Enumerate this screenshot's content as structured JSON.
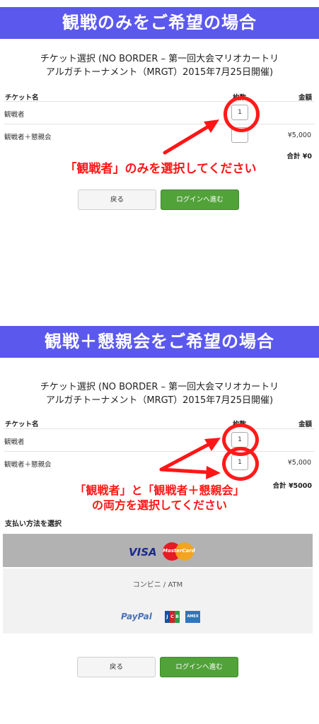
{
  "section1": {
    "banner": "観戦のみをご希望の場合",
    "title_line1": "チケット選択 (NO BORDER – 第一回大会マリオカートリ",
    "title_line2": "アルガチトーナメント（MRGT）2015年7月25日開催)",
    "headers": {
      "name": "チケット名",
      "qty": "枚数",
      "price": "金額"
    },
    "rows": [
      {
        "name": "観戦者",
        "qty": "1",
        "price": ""
      },
      {
        "name": "観戦者＋懇親会",
        "qty": "",
        "price": "¥5,000"
      }
    ],
    "total": "合計 ¥0",
    "annotation": "「観戦者」のみを選択してください",
    "back_label": "戻る",
    "login_label": "ログインへ進む"
  },
  "section2": {
    "banner": "観戦＋懇親会をご希望の場合",
    "title_line1": "チケット選択 (NO BORDER – 第一回大会マリオカートリ",
    "title_line2": "アルガチトーナメント（MRGT）2015年7月25日開催)",
    "headers": {
      "name": "チケット名",
      "qty": "枚数",
      "price": "金額"
    },
    "rows": [
      {
        "name": "観戦者",
        "qty": "1",
        "price": ""
      },
      {
        "name": "観戦者＋懇親会",
        "qty": "1",
        "price": "¥5,000"
      }
    ],
    "total": "合計 ¥5000",
    "annotation_line1": "「観戦者」と「観戦者＋懇親会」",
    "annotation_line2": "の両方を選択してください",
    "payment_label": "支払い方法を選択",
    "payment_options": {
      "card_visa": "VISA",
      "card_mastercard": "MasterCard",
      "convenience": "コンビニ / ATM",
      "paypal": "PayPal",
      "jcb": "JCB",
      "amex": "AMEX"
    },
    "back_label": "戻る",
    "login_label": "ログインへ進む"
  },
  "colors": {
    "banner": "#5b58ee",
    "annotation": "#ff1616",
    "login_button": "#52a23a",
    "selected_payment": "#b2b2b2"
  }
}
